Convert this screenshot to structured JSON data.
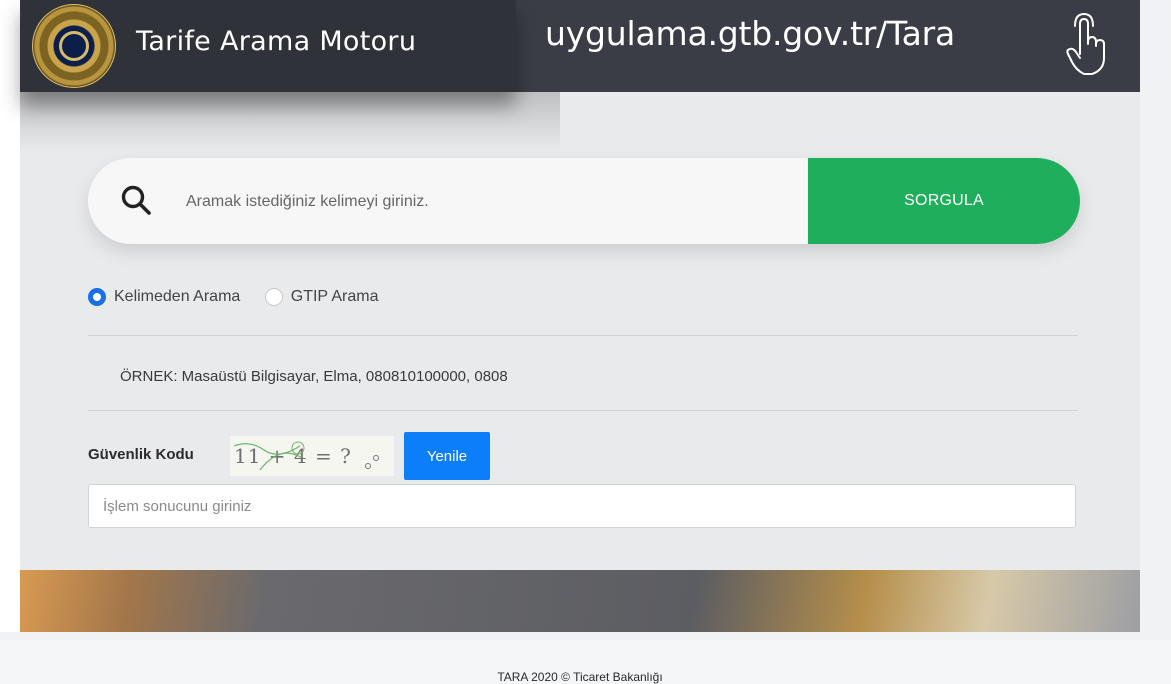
{
  "header": {
    "title": "Tarife Arama Motoru",
    "url": "uygulama.gtb.gov.tr/Tara",
    "logo_icon": "ministry-seal-icon",
    "pointer_icon": "hand-pointer-icon"
  },
  "search": {
    "placeholder": "Aramak istediğiniz kelimeyi giriniz.",
    "value": "",
    "button_label": "SORGULA",
    "icon": "search-icon"
  },
  "search_modes": [
    {
      "label": "Kelimeden Arama",
      "selected": true
    },
    {
      "label": "GTIP Arama",
      "selected": false
    }
  ],
  "example": "ÖRNEK: Masaüstü Bilgisayar, Elma, 080810100000, 0808",
  "security": {
    "label": "Güvenlik Kodu",
    "captcha_text": "11 + 4 = ?",
    "refresh_label": "Yenile",
    "answer_placeholder": "İşlem sonucunu giriniz",
    "answer_value": ""
  },
  "footer": {
    "text": "TARA 2020 © Ticaret Bakanlığı"
  },
  "colors": {
    "primary_green": "#1fae5b",
    "accent_blue": "#0d7efa",
    "radio_blue": "#1a6fe8",
    "header_dark": "#2f3238"
  }
}
